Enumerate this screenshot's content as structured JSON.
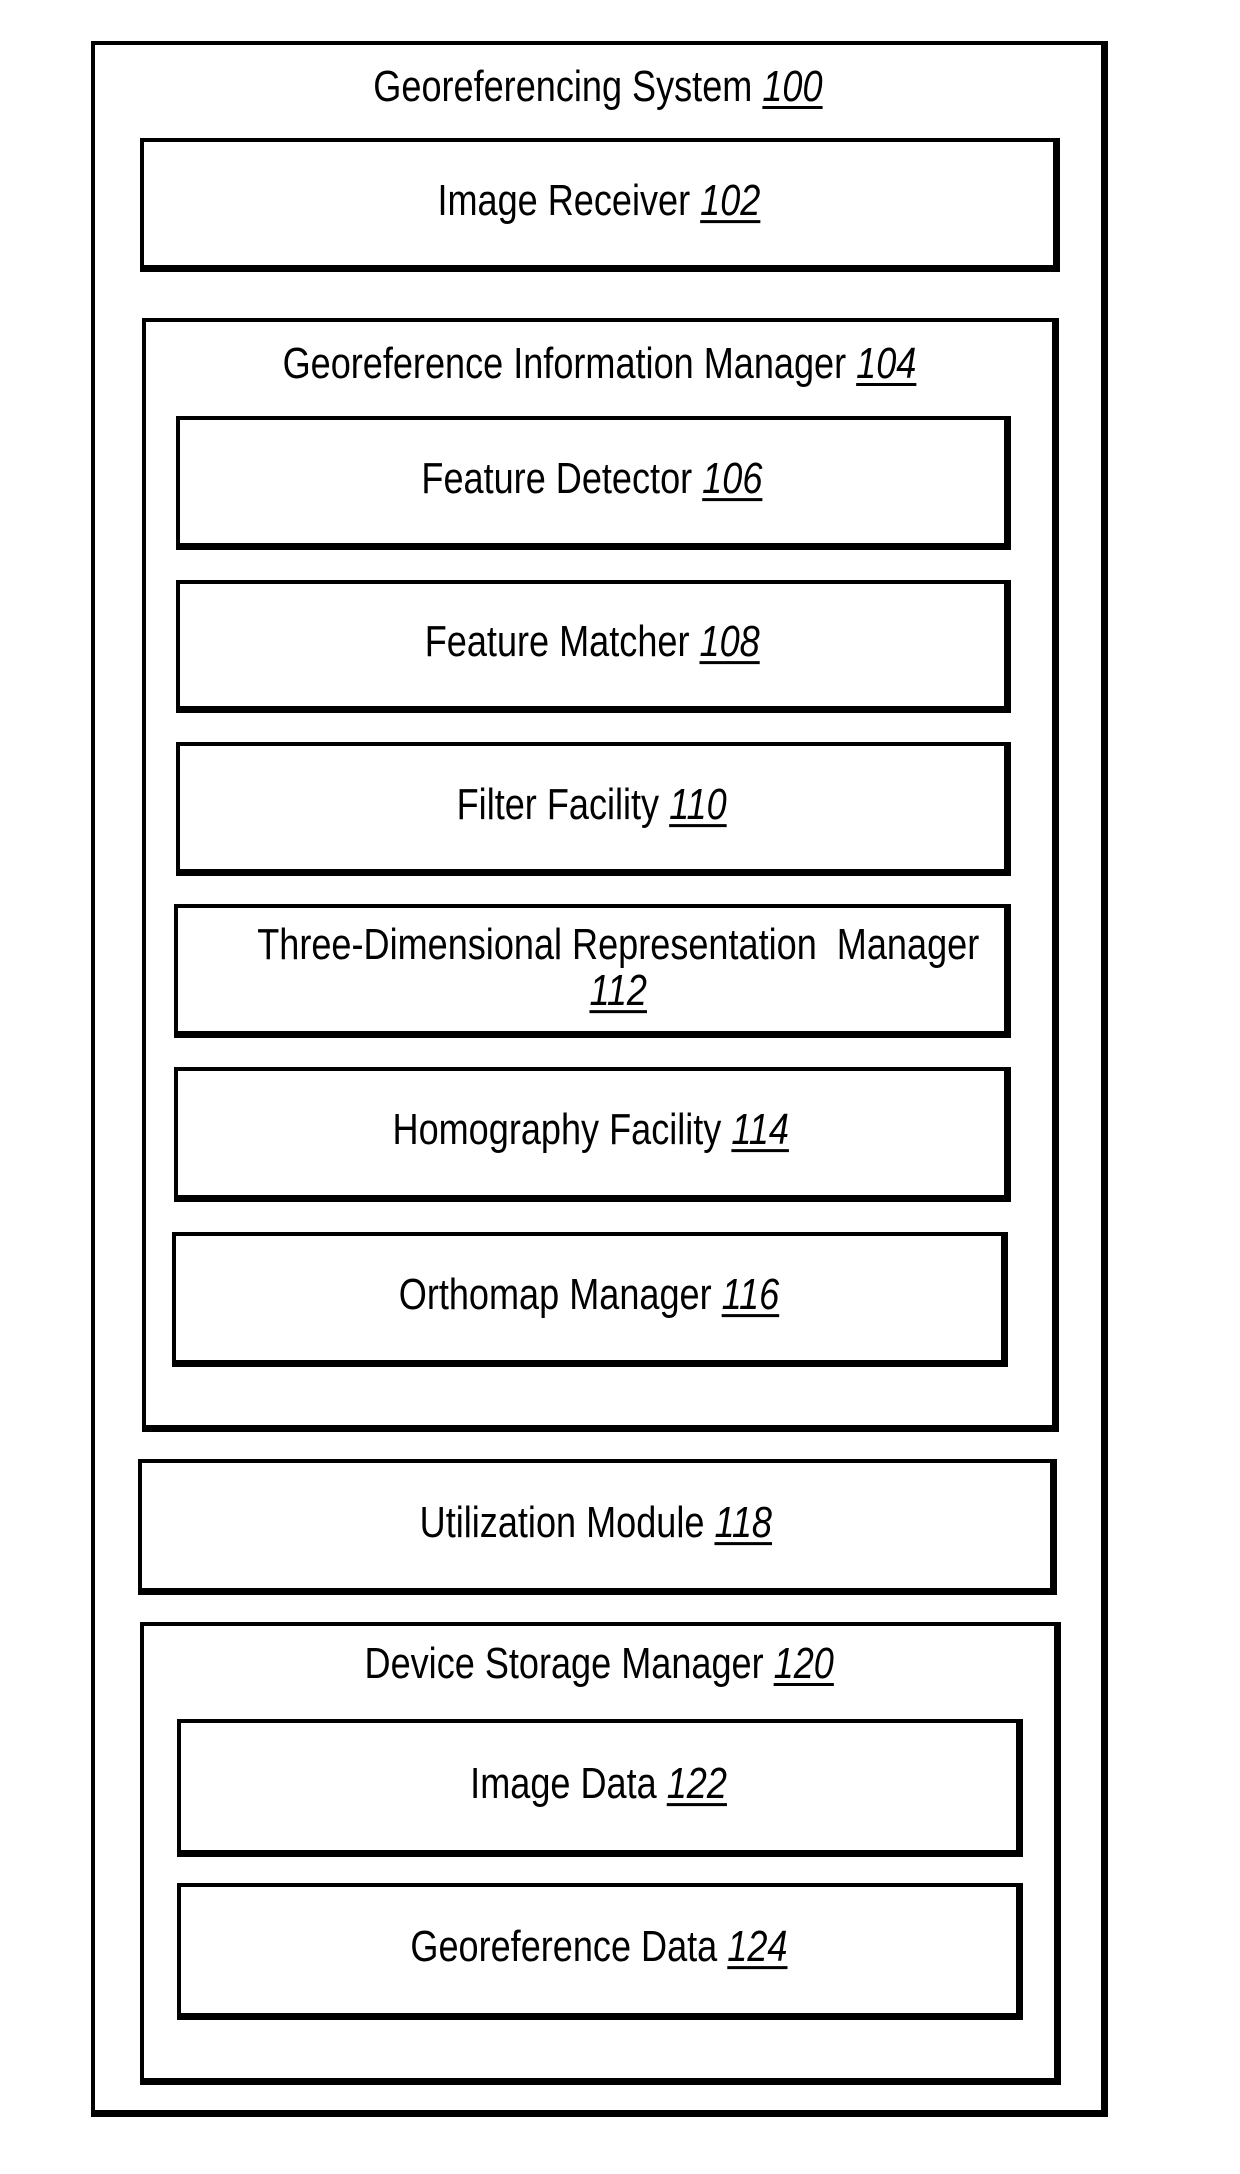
{
  "diagram": {
    "system": {
      "name": "Georeferencing System",
      "ref": "100"
    },
    "image_receiver": {
      "name": "Image Receiver",
      "ref": "102"
    },
    "georeference_information_manager": {
      "name": "Georeference Information Manager",
      "ref": "104",
      "components": [
        {
          "name": "Feature Detector",
          "ref": "106"
        },
        {
          "name": "Feature Matcher",
          "ref": "108"
        },
        {
          "name": "Filter Facility",
          "ref": "110"
        },
        {
          "name": "Three-Dimensional Representation  Manager",
          "ref": "112"
        },
        {
          "name": "Homography Facility",
          "ref": "114"
        },
        {
          "name": "Orthomap Manager",
          "ref": "116"
        }
      ]
    },
    "utilization_module": {
      "name": "Utilization Module",
      "ref": "118"
    },
    "device_storage_manager": {
      "name": "Device Storage Manager",
      "ref": "120",
      "components": [
        {
          "name": "Image Data",
          "ref": "122"
        },
        {
          "name": "Georeference Data",
          "ref": "124"
        }
      ]
    }
  }
}
